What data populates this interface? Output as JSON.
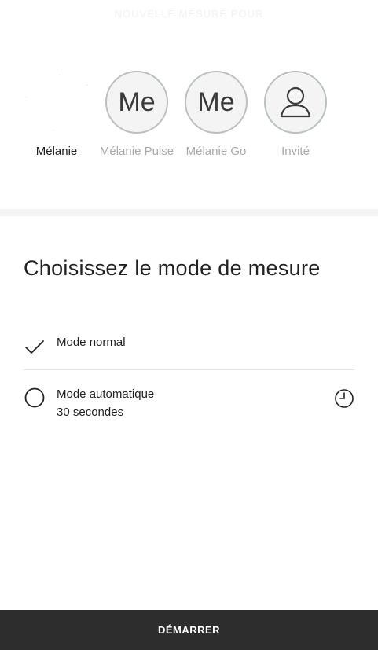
{
  "header": {
    "title": "NOUVELLE MESURE POUR"
  },
  "users": [
    {
      "name": "Mélanie",
      "initials": "",
      "selected": true
    },
    {
      "name": "Mélanie Pulse",
      "initials": "Me",
      "selected": false
    },
    {
      "name": "Mélanie Go",
      "initials": "Me",
      "selected": false
    },
    {
      "name": "Invité",
      "initials": "",
      "icon": "person-icon",
      "selected": false
    }
  ],
  "mode": {
    "title": "Choisissez le mode de mesure",
    "options": [
      {
        "label": "Mode normal",
        "checked": true,
        "icon": "checkmark-icon"
      },
      {
        "label": "Mode automatique",
        "sublabel": "30 secondes",
        "checked": false,
        "icon": "radio-circle-icon",
        "trailing_icon": "clock-icon"
      }
    ]
  },
  "footer": {
    "start_label": "DÉMARRER"
  },
  "colors": {
    "bar": "#2d2d2d",
    "avatar_border": "#b9c0bd",
    "muted_text": "#a9a9a9"
  }
}
